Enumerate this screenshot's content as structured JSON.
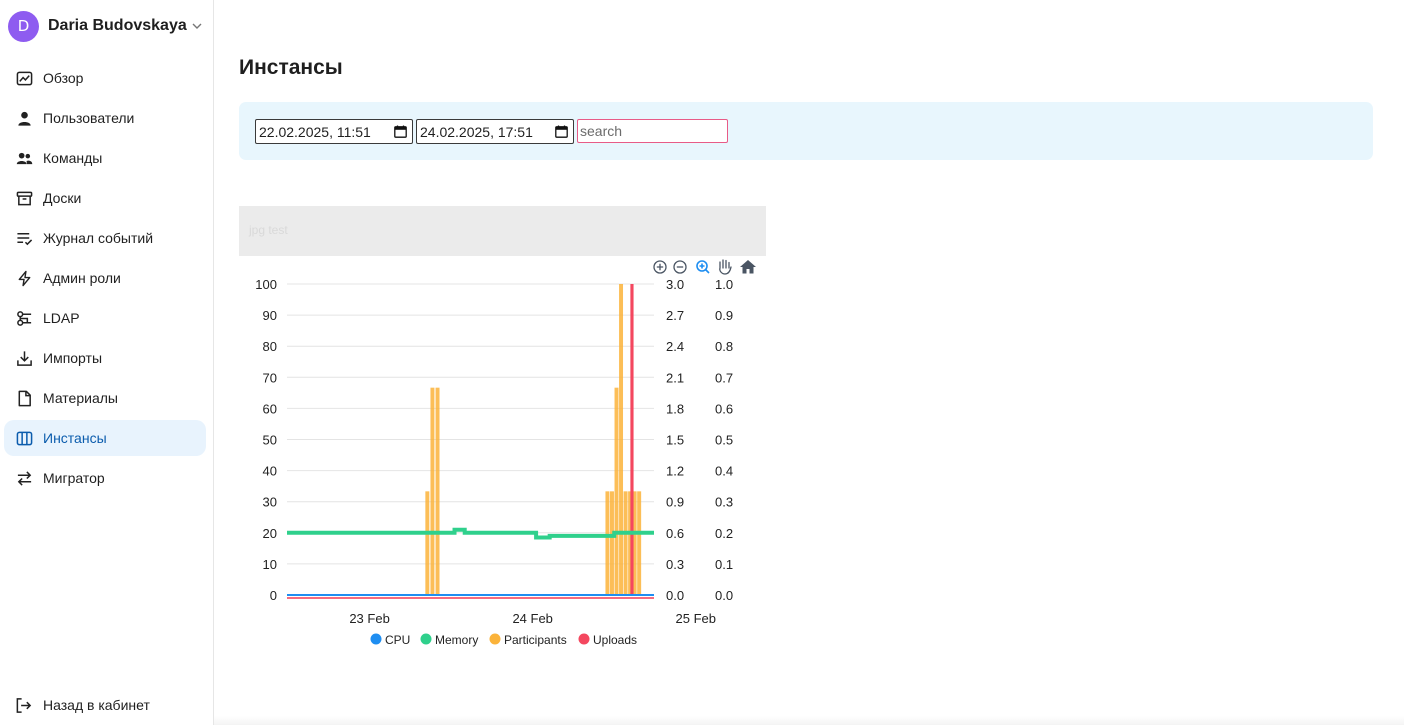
{
  "user": {
    "initial": "D",
    "name": "Daria Budovskaya"
  },
  "nav": [
    {
      "label": "Обзор",
      "icon": "chart-icon",
      "active": false
    },
    {
      "label": "Пользователи",
      "icon": "user-icon",
      "active": false
    },
    {
      "label": "Команды",
      "icon": "users-icon",
      "active": false
    },
    {
      "label": "Доски",
      "icon": "archive-icon",
      "active": false
    },
    {
      "label": "Журнал событий",
      "icon": "list-check-icon",
      "active": false
    },
    {
      "label": "Админ роли",
      "icon": "bolt-icon",
      "active": false
    },
    {
      "label": "LDAP",
      "icon": "ldap-icon",
      "active": false
    },
    {
      "label": "Импорты",
      "icon": "import-icon",
      "active": false
    },
    {
      "label": "Материалы",
      "icon": "file-icon",
      "active": false
    },
    {
      "label": "Инстансы",
      "icon": "columns-icon",
      "active": true
    },
    {
      "label": "Мигратор",
      "icon": "swap-icon",
      "active": false
    }
  ],
  "back_label": "Назад в кабинет",
  "page_title": "Инстансы",
  "filters": {
    "date_from": "22.02.2025, 11:51",
    "date_to": "24.02.2025, 17:51",
    "search_placeholder": "search"
  },
  "image_alt": "jpg test",
  "colors": {
    "accent": "#0b5cad",
    "cpu": "#1f8ef1",
    "memory": "#2fd08c",
    "participants": "#fbb33a",
    "uploads": "#f4475f"
  },
  "chart_data": {
    "type": "bar",
    "x_range": [
      "2025-02-22T11:51",
      "2025-02-24T17:51"
    ],
    "x_ticks": [
      "23 Feb",
      "24 Feb",
      "25 Feb"
    ],
    "y_axes": [
      {
        "ticks": [
          "0",
          "10",
          "20",
          "30",
          "40",
          "50",
          "60",
          "70",
          "80",
          "90",
          "100"
        ],
        "range": [
          0,
          100
        ]
      },
      {
        "ticks": [
          "0.0",
          "0.3",
          "0.6",
          "0.9",
          "1.2",
          "1.5",
          "1.8",
          "2.1",
          "2.4",
          "2.7",
          "3.0"
        ],
        "range": [
          0,
          3
        ]
      },
      {
        "ticks": [
          "0.0",
          "0.1",
          "0.2",
          "0.3",
          "0.4",
          "0.5",
          "0.6",
          "0.7",
          "0.8",
          "0.9",
          "1.0"
        ],
        "range": [
          0,
          1
        ]
      }
    ],
    "legend": [
      "CPU",
      "Memory",
      "Participants",
      "Uploads"
    ],
    "series": [
      {
        "name": "CPU",
        "type": "line",
        "axis": 0,
        "points": [
          [
            "2025-02-22T11:51",
            0
          ],
          [
            "2025-02-24T17:51",
            0
          ]
        ]
      },
      {
        "name": "Memory",
        "type": "line",
        "axis": 0,
        "points": [
          [
            "2025-02-22T11:51",
            20
          ],
          [
            "2025-02-23T12:00",
            20
          ],
          [
            "2025-02-23T12:30",
            21
          ],
          [
            "2025-02-23T14:00",
            20
          ],
          [
            "2025-02-24T00:00",
            20
          ],
          [
            "2025-02-24T00:30",
            18.5
          ],
          [
            "2025-02-24T02:30",
            19
          ],
          [
            "2025-02-24T10:00",
            19
          ],
          [
            "2025-02-24T12:00",
            20
          ],
          [
            "2025-02-24T17:51",
            20
          ]
        ]
      },
      {
        "name": "Participants",
        "type": "bar",
        "axis": 1,
        "bars": [
          [
            "2025-02-23T08:30",
            1
          ],
          [
            "2025-02-23T09:15",
            2
          ],
          [
            "2025-02-23T10:00",
            2
          ],
          [
            "2025-02-24T11:00",
            1
          ],
          [
            "2025-02-24T11:40",
            1
          ],
          [
            "2025-02-24T12:20",
            2
          ],
          [
            "2025-02-24T13:00",
            3
          ],
          [
            "2025-02-24T13:40",
            1
          ],
          [
            "2025-02-24T14:20",
            1
          ],
          [
            "2025-02-24T15:00",
            1
          ],
          [
            "2025-02-24T15:40",
            1
          ]
        ]
      },
      {
        "name": "Uploads",
        "type": "bar",
        "axis": 2,
        "bars": [
          [
            "2025-02-24T14:40",
            1
          ]
        ]
      }
    ],
    "toolbar": [
      "zoom-in-icon",
      "zoom-out-icon",
      "zoom-select-icon",
      "pan-icon",
      "home-icon"
    ]
  }
}
